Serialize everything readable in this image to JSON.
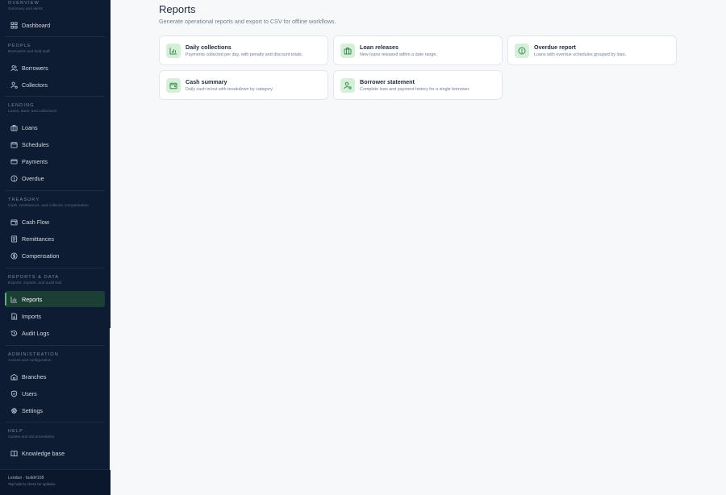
{
  "sidebar": {
    "sections": [
      {
        "title": "Overview",
        "subtitle": "Summary and alerts",
        "items": [
          {
            "label": "Dashboard",
            "icon": "dashboard-icon"
          }
        ]
      },
      {
        "title": "People",
        "subtitle": "Borrowers and field staff",
        "items": [
          {
            "label": "Borrowers",
            "icon": "users-icon"
          },
          {
            "label": "Collectors",
            "icon": "user-badge-icon"
          }
        ]
      },
      {
        "title": "Lending",
        "subtitle": "Loans, dues, and collections",
        "items": [
          {
            "label": "Loans",
            "icon": "briefcase-icon"
          },
          {
            "label": "Schedules",
            "icon": "calendar-icon"
          },
          {
            "label": "Payments",
            "icon": "credit-card-icon"
          },
          {
            "label": "Overdue",
            "icon": "alert-circle-icon"
          }
        ]
      },
      {
        "title": "Treasury",
        "subtitle": "Cash, remittances, and collector compensation",
        "items": [
          {
            "label": "Cash Flow",
            "icon": "wallet-icon"
          },
          {
            "label": "Remittances",
            "icon": "receipt-icon"
          },
          {
            "label": "Compensation",
            "icon": "dollar-circle-icon"
          }
        ]
      },
      {
        "title": "Reports & Data",
        "subtitle": "Exports, imports, and audit trail",
        "items": [
          {
            "label": "Reports",
            "icon": "bar-chart-icon",
            "active": true
          },
          {
            "label": "Imports",
            "icon": "file-import-icon"
          },
          {
            "label": "Audit Logs",
            "icon": "history-icon"
          }
        ]
      },
      {
        "title": "Administration",
        "subtitle": "Access and configuration",
        "items": [
          {
            "label": "Branches",
            "icon": "building-icon"
          },
          {
            "label": "Users",
            "icon": "shield-icon"
          },
          {
            "label": "Settings",
            "icon": "gear-icon"
          }
        ]
      },
      {
        "title": "Help",
        "subtitle": "Guides and documentation",
        "items": [
          {
            "label": "Knowledge base",
            "icon": "book-icon"
          }
        ]
      }
    ],
    "footer": {
      "line1": "Lendun · build#108",
      "line2": "Tap build to check for updates"
    }
  },
  "main": {
    "title": "Reports",
    "subtitle": "Generate operational reports and export to CSV for offline workflows.",
    "cards": [
      {
        "title": "Daily collections",
        "description": "Payments collected per day, with penalty and discount totals.",
        "icon": "bar-chart-icon"
      },
      {
        "title": "Loan releases",
        "description": "New loans released within a date range.",
        "icon": "briefcase-icon"
      },
      {
        "title": "Overdue report",
        "description": "Loans with overdue schedules grouped by loan.",
        "icon": "alert-circle-icon"
      },
      {
        "title": "Cash summary",
        "description": "Daily cash in/out with breakdown by category.",
        "icon": "wallet-icon"
      },
      {
        "title": "Borrower statement",
        "description": "Complete loan and payment history for a single borrower.",
        "icon": "user-badge-icon"
      }
    ]
  },
  "colors": {
    "sidebar_bg": "#0d1b33",
    "active_bg": "#1c3f35",
    "accent": "#3fbf6f",
    "icon_tile": "#d6efd9"
  }
}
